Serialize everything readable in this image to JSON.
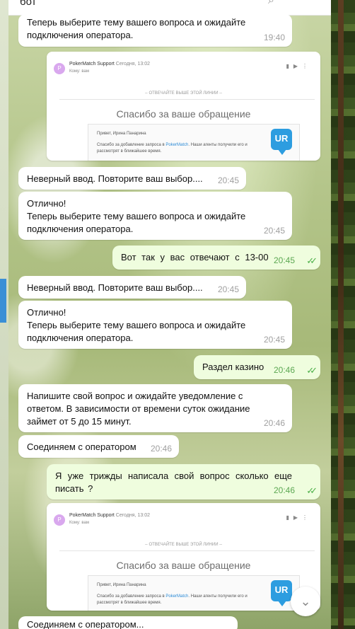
{
  "header": {
    "title": "бот"
  },
  "messages": [
    {
      "text": "Теперь выберите тему вашего вопроса и ожидайте подключения оператора.",
      "time": "19:40"
    },
    {
      "text": "Неверный ввод. Повторите ваш выбор....",
      "time": "20:45"
    },
    {
      "line1": "Отлично!",
      "line2": "Теперь выберите тему вашего вопроса и ожидайте подключения оператора.",
      "time": "20:45"
    },
    {
      "text": "Вот так у вас отвечают с 13-00",
      "time": "20:45"
    },
    {
      "text": "Неверный ввод. Повторите ваш выбор....",
      "time": "20:45"
    },
    {
      "line1": "Отлично!",
      "line2": "Теперь выберите тему вашего вопроса и ожидайте подключения оператора.",
      "time": "20:45"
    },
    {
      "text": "Раздел казино",
      "time": "20:46"
    },
    {
      "text": "Напишите свой вопрос и ожидайте уведомление с ответом. В зависимости от времени суток ожидание займет от 5 до 15 минут.",
      "time": "20:46"
    },
    {
      "text": "Соединяем с оператором",
      "time": "20:46"
    },
    {
      "text": "Я уже трижды написала свой вопрос сколько еще писать ?",
      "time": "20:46"
    }
  ],
  "email": {
    "avatar": "P",
    "sender": "PokerMatch Support",
    "date": "Сегодня, 13:02",
    "to": "Кому: вам",
    "divider": "-- ОТВЕЧАЙТЕ ВЫШЕ ЭТОЙ ЛИНИИ --",
    "heading": "Спасибо за ваше обращение",
    "greeting": "Привет, Ирина Панарина",
    "body_prefix": "Спасибо за добавление запроса в",
    "body_link": "PokerMatch",
    "body_suffix": ". Наши агенты получили его и рассмотрят в ближайшее время.",
    "logo": "UR"
  },
  "partial_text": "Соединяем с оператором..."
}
